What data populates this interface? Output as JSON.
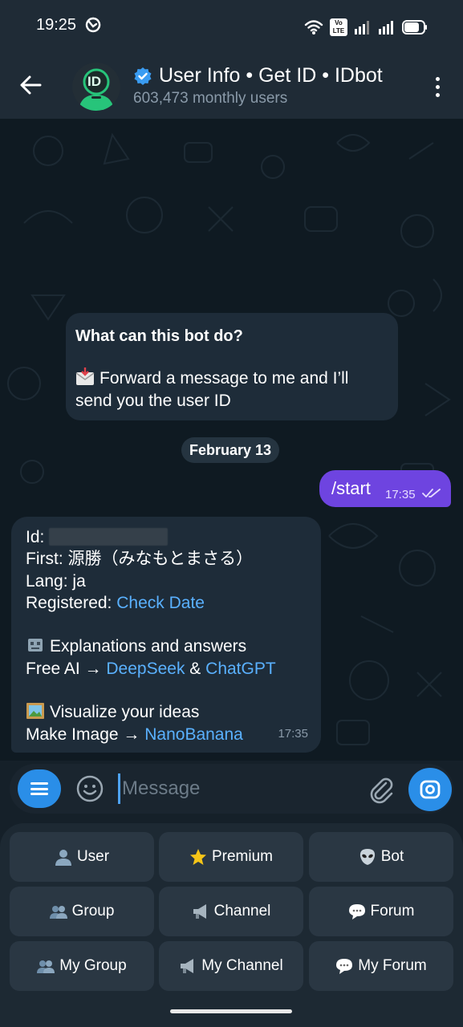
{
  "status_bar": {
    "time": "19:25",
    "network_badge": "Vo LTE"
  },
  "header": {
    "title": "User Info • Get ID • IDbot",
    "subtitle": "603,473 monthly users",
    "avatar_text": "ID"
  },
  "bot_info": {
    "title": "What can this bot do?",
    "text": "Forward a message to me and I’ll send you the user ID",
    "icon": "envelope-icon"
  },
  "date_chip": "February 13",
  "outgoing_message": {
    "text": "/start",
    "time": "17:35"
  },
  "incoming_message": {
    "id_label": "Id:",
    "first_label": "First:",
    "first_value": "源勝（みなもとまさる）",
    "lang_label": "Lang:",
    "lang_value": "ja",
    "registered_label": "Registered:",
    "registered_link": "Check Date",
    "explain_title": "Explanations and answers",
    "free_ai_label": "Free AI →",
    "deepseek_link": "DeepSeek",
    "amp": "&",
    "chatgpt_link": "ChatGPT",
    "visualize_title": "Visualize your ideas",
    "make_image_label": "Make Image →",
    "nanobanana_link": "NanoBanana",
    "time": "17:35"
  },
  "composer": {
    "placeholder": "Message"
  },
  "keyboard": {
    "buttons": [
      {
        "label": "User",
        "icon": "user-silhouette-icon"
      },
      {
        "label": "Premium",
        "icon": "star-icon"
      },
      {
        "label": "Bot",
        "icon": "alien-icon"
      },
      {
        "label": "Group",
        "icon": "users-icon"
      },
      {
        "label": "Channel",
        "icon": "megaphone-icon"
      },
      {
        "label": "Forum",
        "icon": "speech-bubble-icon"
      },
      {
        "label": "My Group",
        "icon": "users-icon"
      },
      {
        "label": "My Channel",
        "icon": "megaphone-icon"
      },
      {
        "label": "My Forum",
        "icon": "speech-bubble-icon"
      }
    ]
  },
  "colors": {
    "header_bg": "#1f2b36",
    "chat_bg": "#0f1a22",
    "outgoing_bubble": "#6e44e0",
    "incoming_bubble": "#1e2c39",
    "accent": "#2a8ee8",
    "link": "#5ab1ff"
  }
}
